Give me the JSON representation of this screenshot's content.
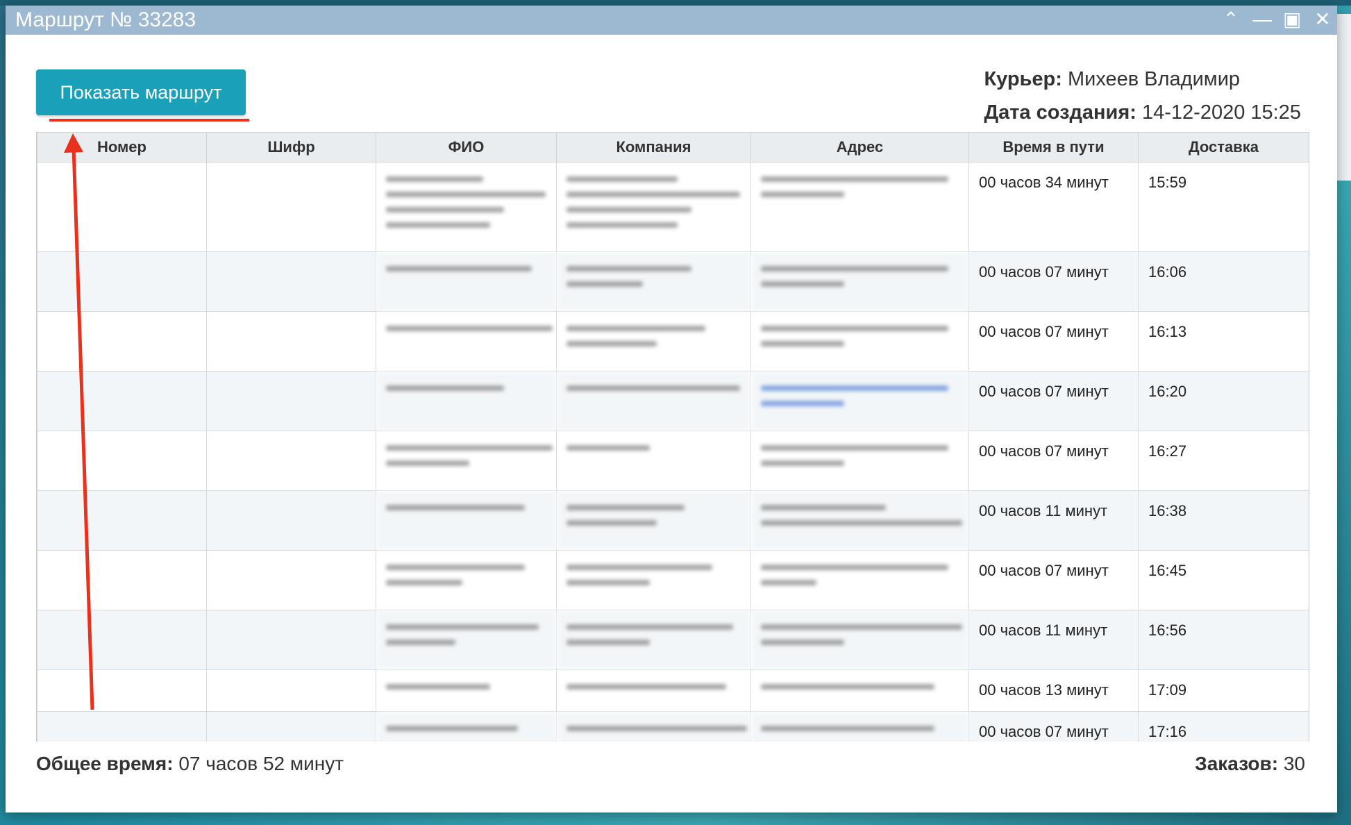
{
  "window": {
    "title": "Маршрут № 33283",
    "controls": [
      "^",
      "_",
      "□",
      "✕"
    ]
  },
  "actions": {
    "show_route_label": "Показать маршрут"
  },
  "info": {
    "courier_label": "Курьер:",
    "courier_value": "Михеев Владимир",
    "created_label": "Дата создания:",
    "created_value": "14-12-2020 15:25"
  },
  "table": {
    "columns": [
      "Номер",
      "Шифр",
      "ФИО",
      "Компания",
      "Адрес",
      "Время в пути",
      "Доставка"
    ],
    "rows": [
      {
        "travel": "00 часов 34 минут",
        "delivery": "15:59"
      },
      {
        "travel": "00 часов 07 минут",
        "delivery": "16:06"
      },
      {
        "travel": "00 часов 07 минут",
        "delivery": "16:13"
      },
      {
        "travel": "00 часов 07 минут",
        "delivery": "16:20"
      },
      {
        "travel": "00 часов 07 минут",
        "delivery": "16:27"
      },
      {
        "travel": "00 часов 11 минут",
        "delivery": "16:38"
      },
      {
        "travel": "00 часов 07 минут",
        "delivery": "16:45"
      },
      {
        "travel": "00 часов 11 минут",
        "delivery": "16:56"
      },
      {
        "travel": "00 часов 13 минут",
        "delivery": "17:09"
      },
      {
        "travel": "00 часов 07 минут",
        "delivery": "17:16"
      }
    ]
  },
  "footer": {
    "total_label": "Общее время:",
    "total_value": "07 часов 52 минут",
    "orders_label": "Заказов:",
    "orders_value": "30"
  },
  "colors": {
    "button": "#1aa0b8",
    "titlebar": "#9db8d1",
    "annotation": "#e8321e"
  }
}
